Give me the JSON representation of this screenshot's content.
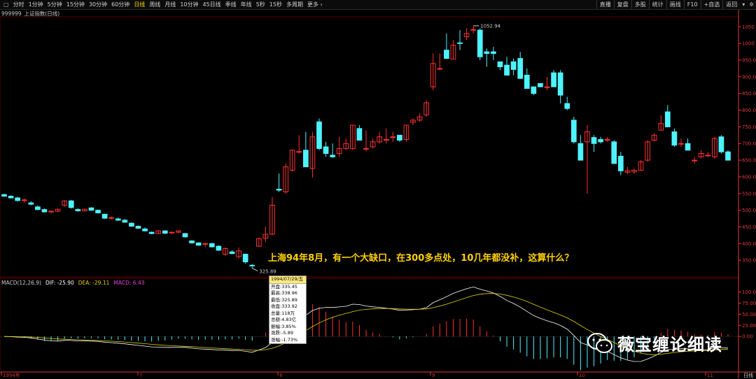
{
  "toolbar": {
    "left_items": [
      "分时",
      "1分钟",
      "5分钟",
      "15分钟",
      "30分钟",
      "60分钟",
      "日线",
      "周线",
      "月线",
      "10分钟",
      "45日线",
      "季线",
      "年线",
      "5秒",
      "15秒",
      "多周期",
      "更多 ›"
    ],
    "active_index": 6,
    "right_items": [
      "直播",
      "复盘",
      "多股",
      "统计",
      "画线",
      "F10",
      "+自选",
      "返回"
    ],
    "right_icons": [
      "dropdown-icon",
      "snowflake-icon"
    ]
  },
  "subtitle": "999999_上证指数(日线)",
  "macd": {
    "label": "MACD(12,26,9)",
    "dif": "DIF: -25.90",
    "dea": "DEA: -29.11",
    "macd": "MACD: 6.43",
    "dif_color": "#ffffff",
    "dea_color": "#e6d200",
    "macd_color": "#e040e0"
  },
  "price_axis": [
    "1050",
    "1000",
    "950.00",
    "900.00",
    "850.00",
    "800.00",
    "750.00",
    "700.00",
    "650.00",
    "600.00",
    "550.00",
    "500.00",
    "450.00",
    "400.00",
    "350.00"
  ],
  "macd_axis": [
    "100.00",
    "75.00",
    "50.00",
    "25.00",
    "0.00"
  ],
  "date_labels": [
    "1994年",
    "7",
    "8",
    "9",
    "10",
    "11"
  ],
  "high_label": "1052.94",
  "low_label": "325.89",
  "annotation": "上海94年8月，有一个大缺口，在300多点处，10几年都没补，这算什么？",
  "tooltip": {
    "date": "1994/07/29/五",
    "rows": [
      "开盘:335.45",
      "最高:338.96",
      "最低:325.89",
      "收盘:333.92",
      "总量:118万",
      "总额:4.83亿",
      "振幅:3.85%",
      "涨跌:-5.89",
      "涨幅:-1.73%"
    ]
  },
  "watermark": "薇宝缠论细读",
  "bottom_right": "日线",
  "colors": {
    "up": "#ff3030",
    "down": "#4df3ff",
    "axis": "#e03a3a",
    "grid": "#5a0000"
  },
  "chart_data": {
    "type": "candlestick",
    "ohlc": [
      [
        547,
        549,
        540,
        542
      ],
      [
        542,
        545,
        535,
        537
      ],
      [
        537,
        540,
        526,
        529
      ],
      [
        529,
        535,
        522,
        531
      ],
      [
        522,
        527,
        515,
        518
      ],
      [
        510,
        514,
        500,
        502
      ],
      [
        502,
        505,
        493,
        495
      ],
      [
        495,
        499,
        490,
        497
      ],
      [
        497,
        505,
        494,
        503
      ],
      [
        515,
        530,
        510,
        528
      ],
      [
        528,
        531,
        505,
        508
      ],
      [
        502,
        506,
        496,
        498
      ],
      [
        498,
        504,
        496,
        503
      ],
      [
        507,
        509,
        498,
        500
      ],
      [
        500,
        502,
        490,
        492
      ],
      [
        488,
        489,
        474,
        476
      ],
      [
        476,
        481,
        472,
        478
      ],
      [
        474,
        478,
        468,
        470
      ],
      [
        470,
        474,
        462,
        464
      ],
      [
        461,
        464,
        450,
        452
      ],
      [
        452,
        454,
        444,
        446
      ],
      [
        444,
        448,
        436,
        438
      ],
      [
        434,
        436,
        428,
        430
      ],
      [
        430,
        440,
        428,
        438
      ],
      [
        438,
        440,
        428,
        431
      ],
      [
        433,
        436,
        428,
        434
      ],
      [
        434,
        440,
        431,
        438
      ],
      [
        430,
        432,
        418,
        420
      ],
      [
        408,
        410,
        400,
        402
      ],
      [
        402,
        404,
        393,
        395
      ],
      [
        398,
        402,
        390,
        400
      ],
      [
        400,
        402,
        388,
        390
      ],
      [
        392,
        395,
        378,
        380
      ],
      [
        368,
        389,
        364,
        385
      ],
      [
        375,
        380,
        368,
        370
      ],
      [
        361,
        388,
        355,
        378
      ],
      [
        368,
        370,
        340,
        345
      ],
      [
        335,
        339,
        326,
        334
      ],
      [
        392,
        418,
        390,
        415
      ],
      [
        416,
        450,
        405,
        428
      ],
      [
        428,
        540,
        425,
        515
      ],
      [
        563,
        610,
        555,
        560
      ],
      [
        555,
        640,
        550,
        630
      ],
      [
        620,
        680,
        615,
        680
      ],
      [
        676,
        725,
        670,
        676
      ],
      [
        680,
        735,
        675,
        630
      ],
      [
        625,
        735,
        598,
        720
      ],
      [
        765,
        775,
        680,
        685
      ],
      [
        690,
        705,
        660,
        670
      ],
      [
        665,
        700,
        657,
        660
      ],
      [
        670,
        720,
        660,
        685
      ],
      [
        685,
        715,
        680,
        700
      ],
      [
        685,
        748,
        680,
        755
      ],
      [
        745,
        755,
        718,
        710
      ],
      [
        685,
        740,
        676,
        685
      ],
      [
        690,
        715,
        685,
        705
      ],
      [
        705,
        735,
        700,
        720
      ],
      [
        710,
        745,
        700,
        712
      ],
      [
        720,
        735,
        705,
        720
      ],
      [
        725,
        710,
        705,
        710
      ],
      [
        712,
        755,
        705,
        755
      ],
      [
        764,
        775,
        755,
        770
      ],
      [
        770,
        790,
        765,
        780
      ],
      [
        786,
        830,
        780,
        822
      ],
      [
        870,
        970,
        860,
        940
      ],
      [
        925,
        970,
        920,
        925
      ],
      [
        980,
        1030,
        960,
        955
      ],
      [
        953,
        1010,
        955,
        995
      ],
      [
        1002,
        1040,
        980,
        1000
      ],
      [
        1020,
        1046,
        1010,
        1030
      ],
      [
        1042,
        1053,
        1030,
        1042
      ],
      [
        1040,
        1045,
        950,
        960
      ],
      [
        975,
        985,
        930,
        970
      ],
      [
        975,
        990,
        950,
        970
      ],
      [
        945,
        945,
        920,
        930
      ],
      [
        935,
        960,
        920,
        905
      ],
      [
        945,
        955,
        905,
        922
      ],
      [
        955,
        975,
        945,
        895
      ],
      [
        905,
        925,
        885,
        865
      ],
      [
        870,
        870,
        845,
        850
      ],
      [
        880,
        880,
        870,
        870
      ],
      [
        870,
        900,
        860,
        870
      ],
      [
        912,
        920,
        870,
        870
      ],
      [
        912,
        920,
        820,
        845
      ],
      [
        820,
        840,
        800,
        805
      ],
      [
        770,
        780,
        700,
        705
      ],
      [
        700,
        725,
        655,
        650
      ],
      [
        705,
        755,
        550,
        735
      ],
      [
        718,
        725,
        675,
        700
      ],
      [
        712,
        720,
        700,
        705
      ],
      [
        710,
        720,
        705,
        712
      ],
      [
        705,
        710,
        640,
        640
      ],
      [
        662,
        675,
        605,
        618
      ],
      [
        614,
        630,
        608,
        618
      ],
      [
        615,
        625,
        610,
        620
      ],
      [
        620,
        650,
        618,
        645
      ],
      [
        650,
        710,
        645,
        705
      ],
      [
        710,
        730,
        705,
        725
      ],
      [
        740,
        785,
        740,
        760
      ],
      [
        795,
        815,
        790,
        750
      ],
      [
        735,
        745,
        690,
        695
      ],
      [
        700,
        715,
        690,
        700
      ],
      [
        700,
        715,
        680,
        680
      ],
      [
        650,
        660,
        640,
        650
      ],
      [
        660,
        680,
        655,
        670
      ],
      [
        665,
        675,
        660,
        665
      ],
      [
        660,
        720,
        655,
        715
      ],
      [
        720,
        725,
        670,
        675
      ],
      [
        675,
        680,
        650,
        650
      ]
    ],
    "price_range": [
      300,
      1080
    ],
    "macd_range": [
      -80,
      120
    ],
    "date_ticks": [
      "1994年",
      "7",
      "8",
      "9",
      "10",
      "11"
    ],
    "annotations": [
      "1052.94",
      "325.89"
    ]
  }
}
